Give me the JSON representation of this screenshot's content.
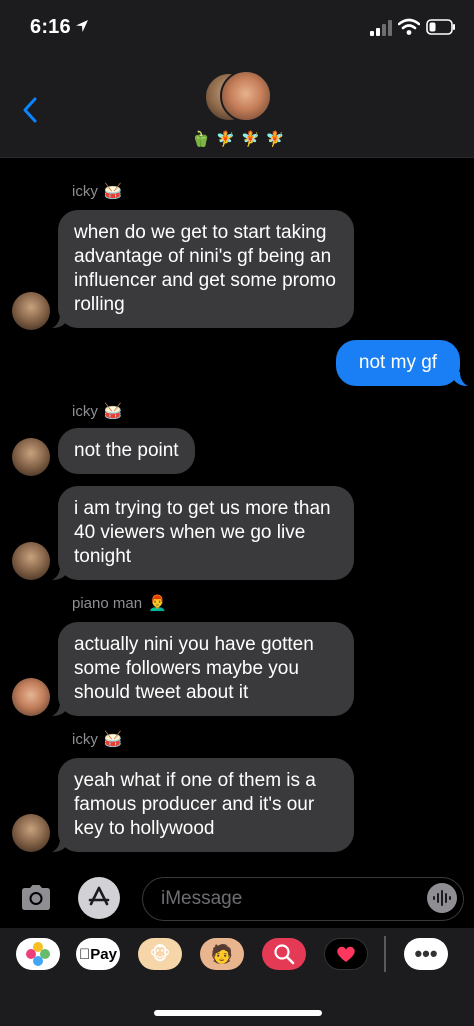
{
  "status_bar": {
    "time": "6:16",
    "location_icon": "location-arrow-icon",
    "signal_icon": "cellular-signal-icon",
    "wifi_icon": "wifi-icon",
    "battery_icon": "battery-icon"
  },
  "header": {
    "back_icon": "chevron-left-icon",
    "member_emojis": [
      "🫑",
      "🧚",
      "🧚",
      "🧚"
    ]
  },
  "messages": [
    {
      "sender": "icky",
      "sender_emoji": "🥁",
      "text": "when do we get to start taking advantage of nini's gf being an influencer and get some promo rolling",
      "direction": "in"
    },
    {
      "text": "not my gf",
      "direction": "out"
    },
    {
      "sender": "icky",
      "sender_emoji": "🥁",
      "text": "not the point",
      "direction": "in"
    },
    {
      "text": "i am trying to get us more than 40 viewers when we go live tonight",
      "direction": "in"
    },
    {
      "sender": "piano man",
      "sender_emoji": "👨‍🦰",
      "text": "actually nini you have gotten some followers maybe you should tweet about it",
      "direction": "in"
    },
    {
      "sender": "icky",
      "sender_emoji": "🥁",
      "text": "yeah what if one of them is a famous producer and it's our key to hollywood",
      "direction": "in"
    }
  ],
  "input": {
    "placeholder": "iMessage",
    "camera_icon": "camera-icon",
    "appstore_icon": "app-store-icon",
    "mic_icon": "audio-waveform-icon"
  },
  "app_drawer": {
    "pay_label": "Pay",
    "more_label": "•••"
  },
  "colors": {
    "outgoing_bubble": "#1a7ff5",
    "incoming_bubble": "#3a3a3c",
    "background": "#000000",
    "bar": "#1c1c1e"
  }
}
